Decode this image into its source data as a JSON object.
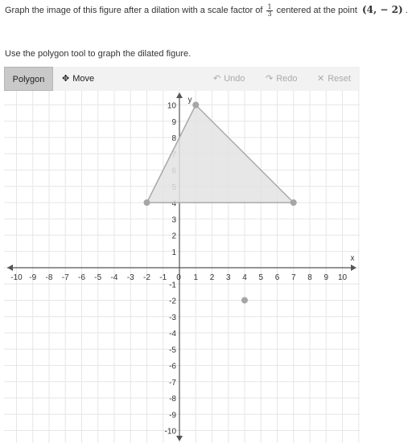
{
  "question": {
    "text_before": "Graph the image of this figure after a dilation with a scale factor of",
    "scale_numerator": "1",
    "scale_denominator": "3",
    "text_middle": "centered at the point",
    "center_point": "(4,  − 2)",
    "text_after": "."
  },
  "instruction": "Use the polygon tool to graph the dilated figure.",
  "toolbar": {
    "polygon_label": "Polygon",
    "move_label": "Move",
    "move_icon": "move-arrows-icon",
    "undo_label": "Undo",
    "undo_icon": "undo-arrow-icon",
    "redo_label": "Redo",
    "redo_icon": "redo-arrow-icon",
    "reset_label": "Reset",
    "reset_icon": "x-icon"
  },
  "graph": {
    "x_axis_label": "x",
    "y_axis_label": "y",
    "x_range": [
      -10,
      10
    ],
    "y_range": [
      -10,
      10
    ],
    "x_ticks": [
      "-10",
      "-9",
      "-8",
      "-7",
      "-6",
      "-5",
      "-4",
      "-3",
      "-2",
      "-1",
      "0",
      "1",
      "2",
      "3",
      "4",
      "5",
      "6",
      "7",
      "8",
      "9",
      "10"
    ],
    "y_ticks": [
      "10",
      "9",
      "8",
      "7",
      "6",
      "5",
      "4",
      "3",
      "2",
      "1",
      "-1",
      "-2",
      "-3",
      "-4",
      "-5",
      "-6",
      "-7",
      "-8",
      "-9",
      "-10"
    ],
    "polygon_vertices": [
      [
        -2,
        4
      ],
      [
        1,
        10
      ],
      [
        7,
        4
      ]
    ],
    "center_point": [
      4,
      -2
    ],
    "colors": {
      "polygon_fill": "#e3e3e3",
      "polygon_stroke": "#a8a8a8",
      "point": "#a6a6a6",
      "grid": "#e6e6e6",
      "axis": "#555555"
    }
  }
}
